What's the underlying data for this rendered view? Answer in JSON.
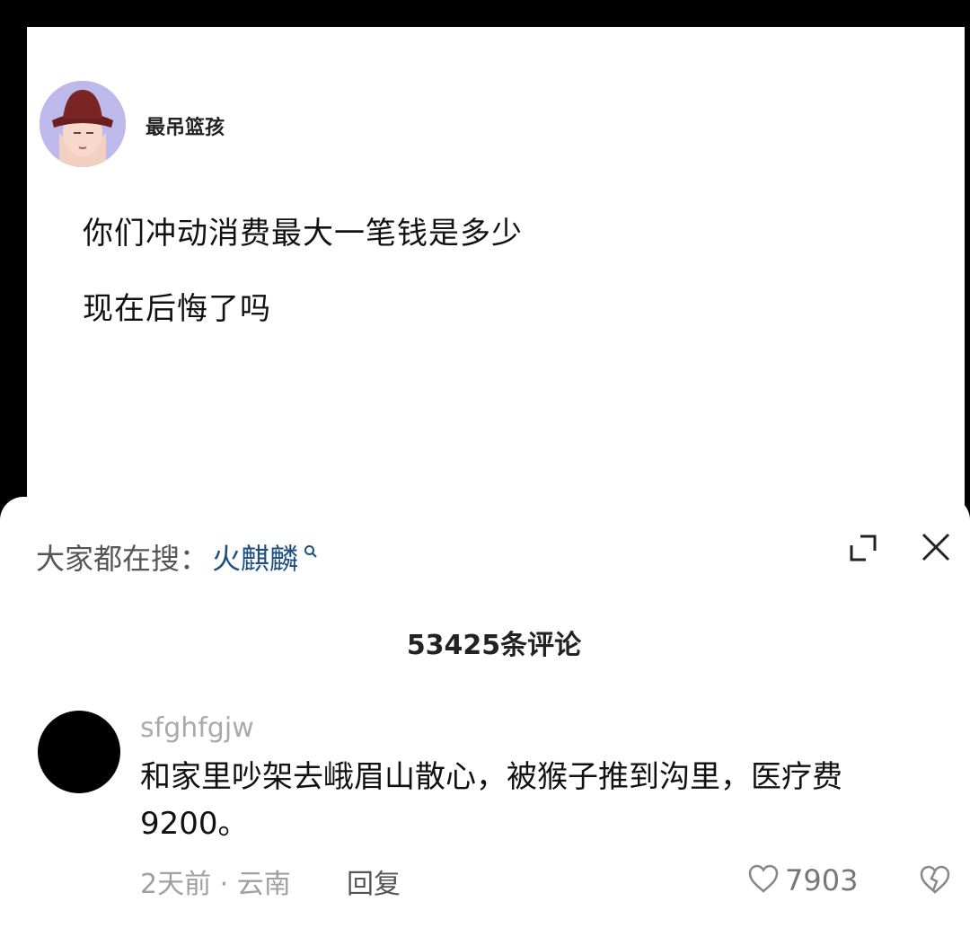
{
  "post": {
    "author": "最吊篮孩",
    "lines": [
      "你们冲动消费最大一笔钱是多少",
      "现在后悔了吗"
    ]
  },
  "sheet": {
    "hot_search_label": "大家都在搜：",
    "hot_search_keyword": "火麒麟",
    "comment_count": "53425条评论"
  },
  "comment": {
    "username": "sfghfgjw",
    "text": "和家里吵架去峨眉山散心，被猴子推到沟里，医疗费9200。",
    "meta": "2天前 · 云南",
    "reply_label": "回复",
    "like_count": "7903"
  },
  "icons": {
    "search": "search-icon",
    "expand": "expand-icon",
    "close": "close-icon",
    "like": "heart-icon",
    "dislike": "broken-heart-icon"
  }
}
